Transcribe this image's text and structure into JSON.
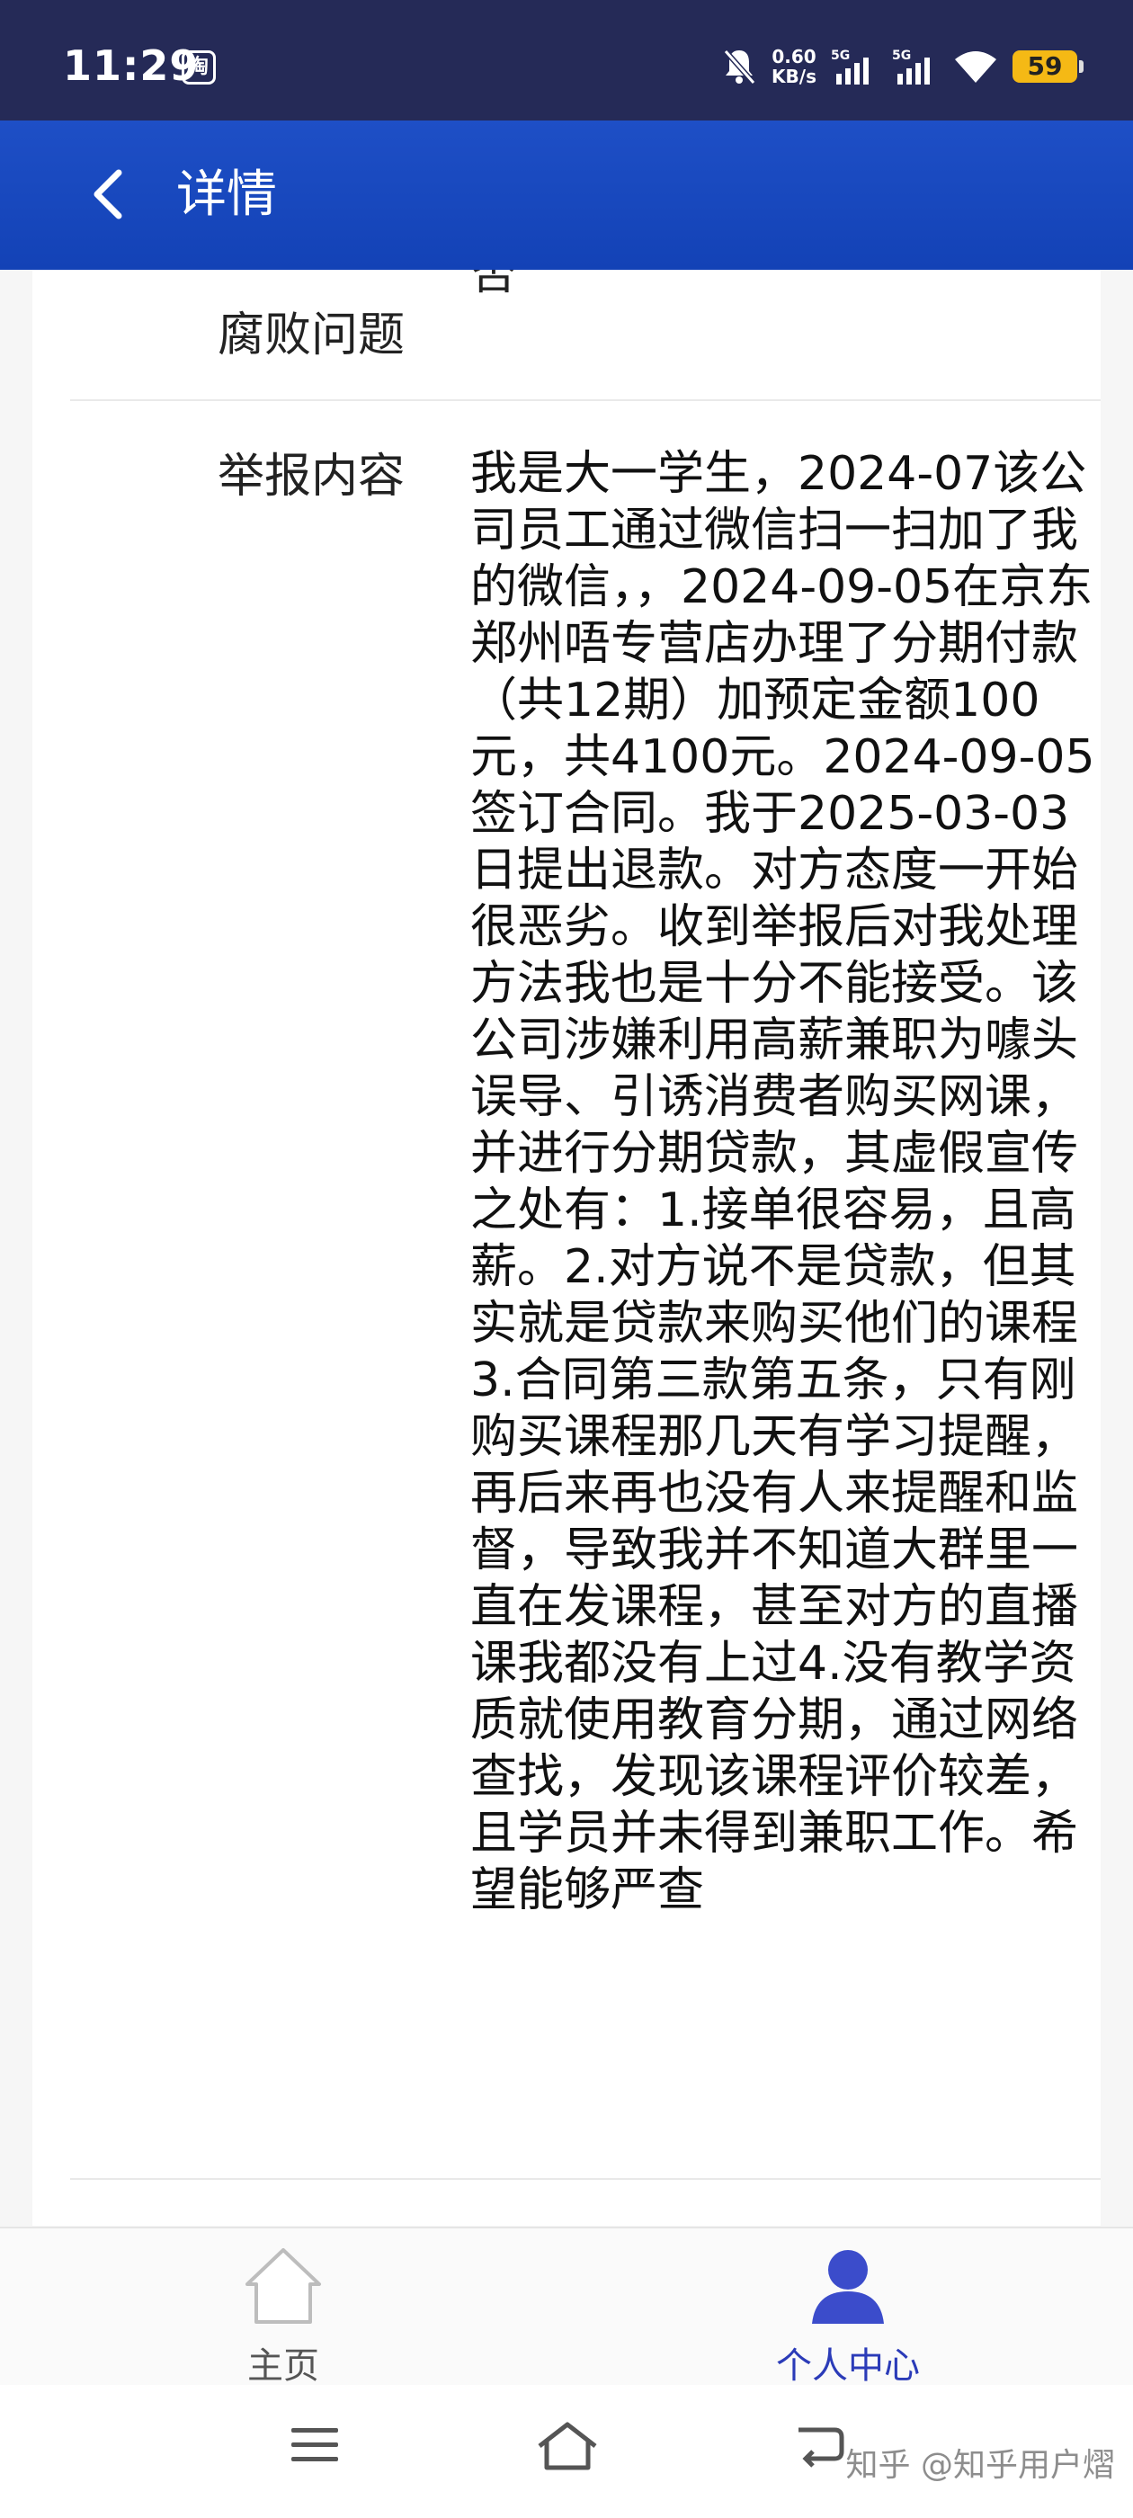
{
  "status_bar": {
    "time": "11:29",
    "app_badge": "淘",
    "net_speed_value": "0.60",
    "net_speed_unit": "KB/s",
    "signal1_label": "5G",
    "signal2_label": "5G",
    "battery": "59"
  },
  "header": {
    "title": "详情"
  },
  "content": {
    "prev_field_value_cut": "否",
    "prev_field_label_line2": "腐败问题",
    "report_label": "举报内容",
    "report_text": "我是大一学生，2024-07该公司员工通过微信扫一扫加了我的微信，，2024-09-05在京东郑州唔专营店办理了分期付款（共12期）加预定金额100元，共4100元。2024-09-05签订合同。我于2025-03-03日提出退款。对方态度一开始很恶劣。收到举报后对我处理方法我也是十分不能接受。该公司涉嫌利用高薪兼职为噱头误导、引诱消费者购买网课，并进行分期贷款，其虚假宣传之处有：1.接单很容易，且高薪。2.对方说不是贷款，但其实就是贷款来购买他们的课程3.合同第三款第五条，只有刚购买课程那几天有学习提醒，再后来再也没有人来提醒和监督，导致我并不知道大群里一直在发课程，甚至对方的直播课我都没有上过4.没有教学资质就使用教育分期，通过网络查找，发现该课程评价较差，且学员并未得到兼职工作。希望能够严查"
  },
  "bottom_nav": {
    "home_label": "主页",
    "me_label": "个人中心",
    "active": "个人中心",
    "active_color": "#2b3bb8"
  },
  "watermark": "知乎 @知乎用户熠"
}
